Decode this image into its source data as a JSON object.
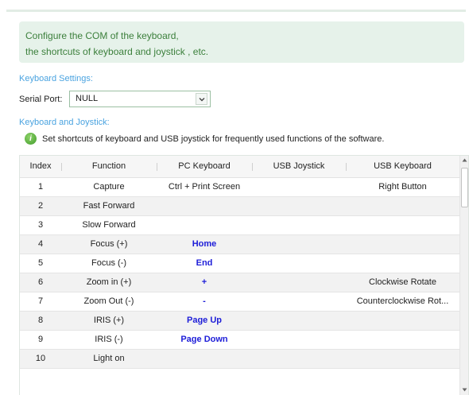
{
  "info": {
    "line1": "Configure the COM of the keyboard,",
    "line2": "the shortcuts of keyboard and joystick , etc."
  },
  "keyboard_settings": {
    "title": "Keyboard Settings:",
    "serial_port_label": "Serial Port:",
    "serial_port_value": "NULL"
  },
  "keyboard_joystick": {
    "title": "Keyboard and Joystick:",
    "hint": "Set shortcuts of keyboard and USB joystick for frequently used functions of the software.",
    "hint_icon": "info-icon",
    "hint_icon_glyph": "i"
  },
  "table": {
    "columns": [
      "Index",
      "Function",
      "PC Keyboard",
      "USB Joystick",
      "USB Keyboard"
    ],
    "rows": [
      {
        "index": "1",
        "function": "Capture",
        "pc": "Ctrl + Print Screen",
        "joystick": "",
        "usb": "Right Button"
      },
      {
        "index": "2",
        "function": "Fast Forward",
        "pc": "",
        "joystick": "",
        "usb": ""
      },
      {
        "index": "3",
        "function": "Slow Forward",
        "pc": "",
        "joystick": "",
        "usb": ""
      },
      {
        "index": "4",
        "function": "Focus (+)",
        "pc": "Home",
        "joystick": "",
        "usb": ""
      },
      {
        "index": "5",
        "function": "Focus (-)",
        "pc": "End",
        "joystick": "",
        "usb": ""
      },
      {
        "index": "6",
        "function": "Zoom in (+)",
        "pc": "+",
        "joystick": "",
        "usb": "Clockwise Rotate"
      },
      {
        "index": "7",
        "function": "Zoom Out (-)",
        "pc": "-",
        "joystick": "",
        "usb": "Counterclockwise Rot..."
      },
      {
        "index": "8",
        "function": "IRIS (+)",
        "pc": "Page Up",
        "joystick": "",
        "usb": ""
      },
      {
        "index": "9",
        "function": "IRIS (-)",
        "pc": "Page Down",
        "joystick": "",
        "usb": ""
      },
      {
        "index": "10",
        "function": "Light on",
        "pc": "",
        "joystick": "",
        "usb": ""
      }
    ]
  },
  "colors": {
    "info_bg": "#e6f2ea",
    "info_text": "#3b7f3b",
    "section_label": "#4aa3e0",
    "link_text": "#1d1dd8",
    "row_alt": "#f2f2f2"
  }
}
